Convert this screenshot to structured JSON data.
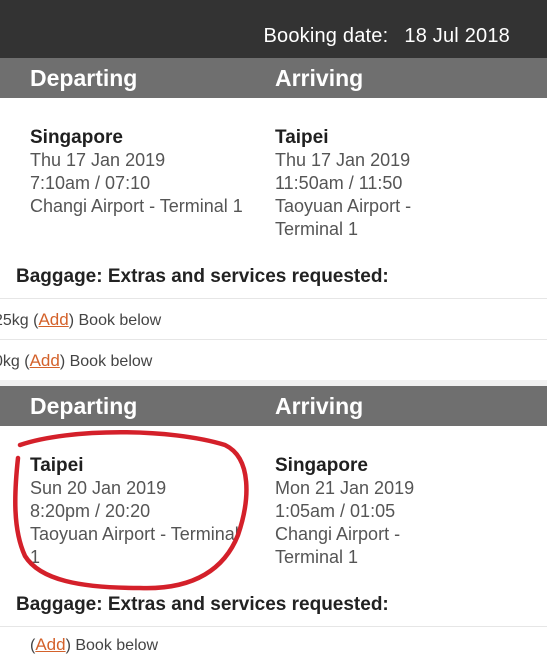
{
  "header": {
    "booking_label": "Booking date:",
    "booking_value": "18 Jul 2018"
  },
  "outbound": {
    "col_departing": "Departing",
    "col_arriving": "Arriving",
    "depart": {
      "city": "Singapore",
      "date": "Thu 17 Jan 2019",
      "time": "7:10am / 07:10",
      "airport": "Changi Airport - Terminal 1"
    },
    "arrive": {
      "city": "Taipei",
      "date": "Thu 17 Jan 2019",
      "time": "11:50am / 11:50",
      "airport_line1": "Taoyuan Airport -",
      "airport_line2": "Terminal 1"
    },
    "baggage_title": "Baggage:  Extras and services requested:",
    "rows": [
      {
        "prefix": "25kg (",
        "add": "Add",
        "suffix": ") Book below"
      },
      {
        "prefix": "0kg (",
        "add": "Add",
        "suffix": ")   Book below"
      }
    ]
  },
  "inbound": {
    "col_departing": "Departing",
    "col_arriving": "Arriving",
    "depart": {
      "city": "Taipei",
      "date": "Sun 20 Jan 2019",
      "time": "8:20pm / 20:20",
      "airport_line1": "Taoyuan Airport - Terminal",
      "airport_line2": "1"
    },
    "arrive": {
      "city": "Singapore",
      "date": "Mon 21 Jan 2019",
      "time": "1:05am / 01:05",
      "airport_line1": "Changi Airport -",
      "airport_line2": "Terminal 1"
    },
    "baggage_title": "Baggage:  Extras and services requested:",
    "rows": [
      {
        "prefix": "(",
        "add": "Add",
        "suffix": ") Book below"
      }
    ]
  },
  "annotation": {
    "color": "#d4202a"
  }
}
